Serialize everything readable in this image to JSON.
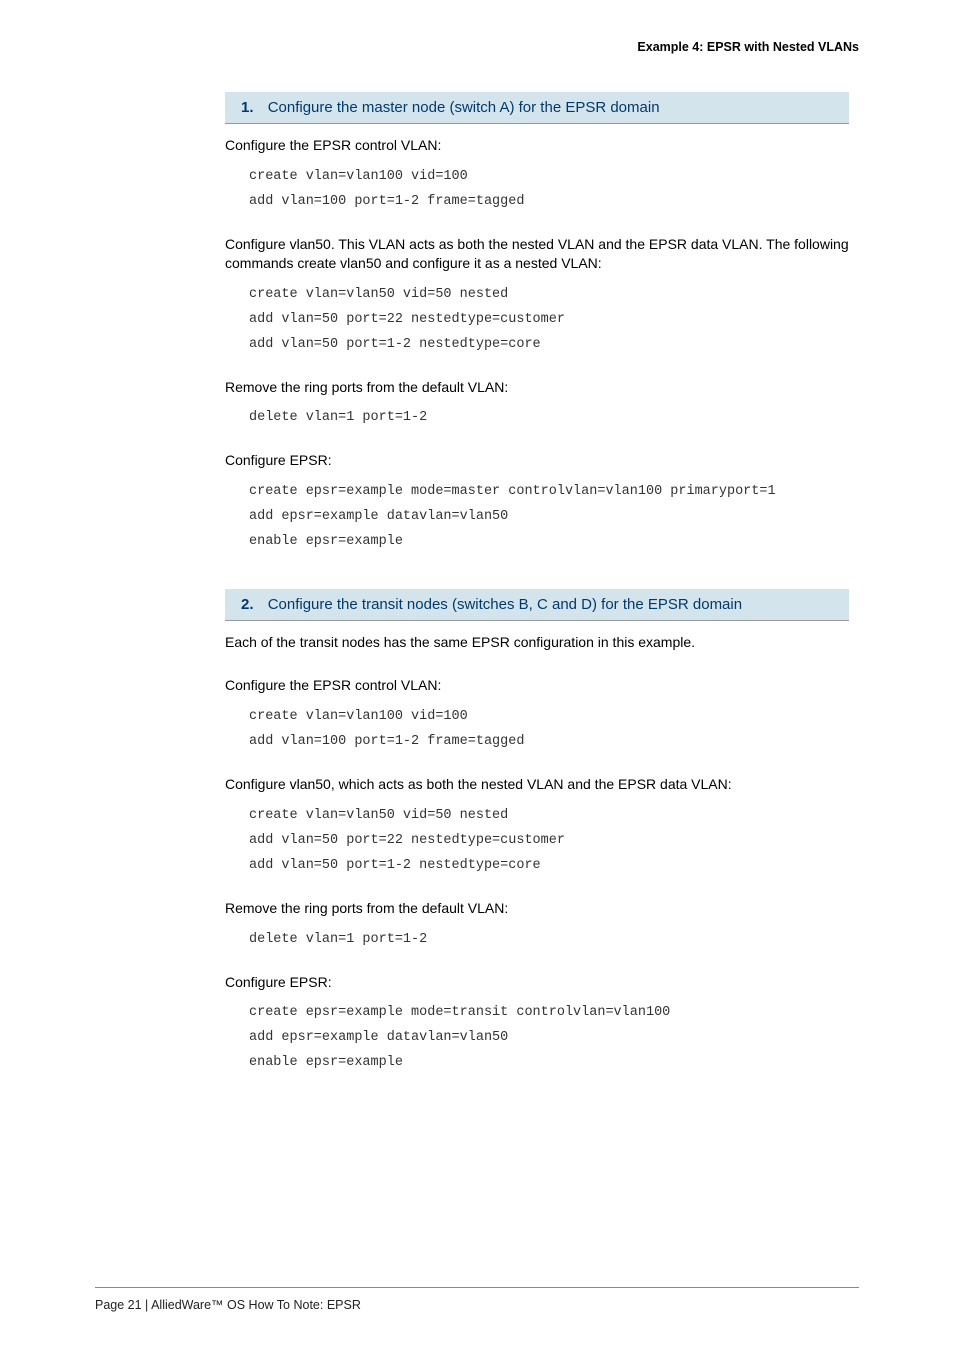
{
  "header": "Example 4: EPSR with Nested VLANs",
  "steps": [
    {
      "num": "1.",
      "title": "Configure the master node (switch A) for the EPSR domain",
      "blocks": [
        {
          "desc": "Configure the EPSR control VLAN:",
          "code": "create vlan=vlan100 vid=100\nadd vlan=100 port=1-2 frame=tagged"
        },
        {
          "desc": "Configure vlan50. This VLAN acts as both the nested VLAN and the EPSR data VLAN. The following commands create vlan50 and configure it as a nested VLAN:",
          "code": "create vlan=vlan50 vid=50 nested\nadd vlan=50 port=22 nestedtype=customer\nadd vlan=50 port=1-2 nestedtype=core"
        },
        {
          "desc": "Remove the ring ports from the default VLAN:",
          "code": "delete vlan=1 port=1-2"
        },
        {
          "desc": "Configure EPSR:",
          "code": "create epsr=example mode=master controlvlan=vlan100 primaryport=1\nadd epsr=example datavlan=vlan50\nenable epsr=example"
        }
      ]
    },
    {
      "num": "2.",
      "title": "Configure the transit nodes (switches B, C and D) for the EPSR domain",
      "intro": "Each of the transit nodes has the same EPSR configuration in this example.",
      "blocks": [
        {
          "desc": "Configure the EPSR control VLAN:",
          "code": "create vlan=vlan100 vid=100\nadd vlan=100 port=1-2 frame=tagged"
        },
        {
          "desc": "Configure vlan50, which acts as both the nested VLAN and the EPSR data VLAN:",
          "code": "create vlan=vlan50 vid=50 nested\nadd vlan=50 port=22 nestedtype=customer\nadd vlan=50 port=1-2 nestedtype=core"
        },
        {
          "desc": "Remove the ring ports from the default VLAN:",
          "code": "delete vlan=1 port=1-2"
        },
        {
          "desc": "Configure EPSR:",
          "code": "create epsr=example mode=transit controlvlan=vlan100\nadd epsr=example datavlan=vlan50\nenable epsr=example"
        }
      ]
    }
  ],
  "footer": "Page 21 | AlliedWare™ OS How To Note: EPSR"
}
